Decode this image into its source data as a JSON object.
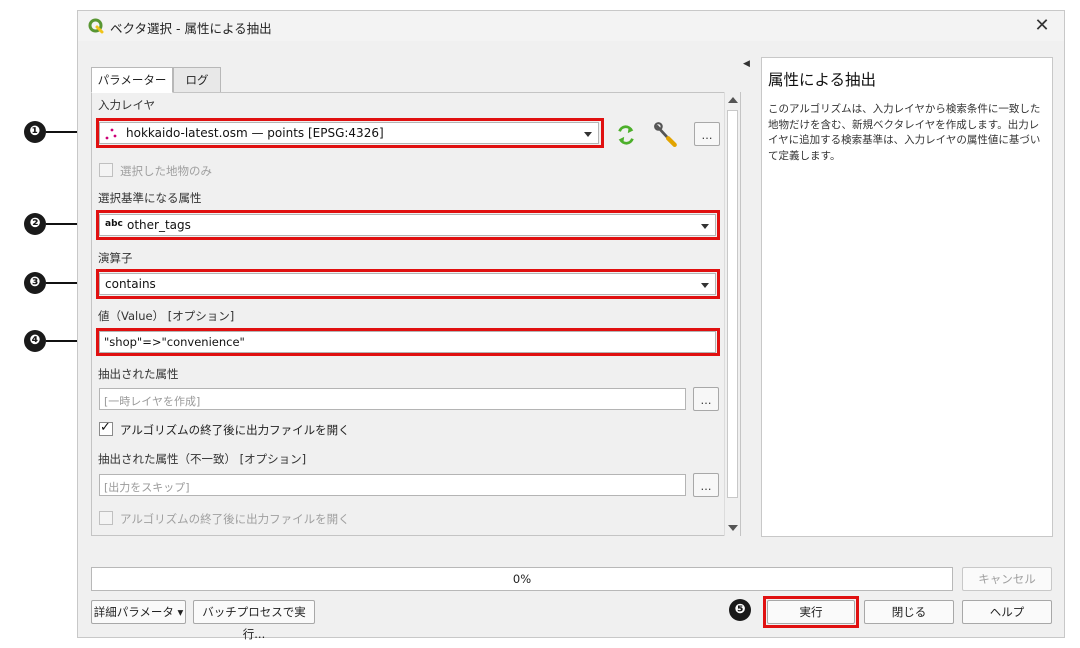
{
  "window": {
    "title": "ベクタ選択 - 属性による抽出",
    "close_glyph": "✕"
  },
  "tabs": [
    {
      "label": "パラメーター"
    },
    {
      "label": "ログ"
    }
  ],
  "params": {
    "input_layer": {
      "label": "入力レイヤ",
      "value": "hokkaido-latest.osm — points [EPSG:4326]",
      "dots": "…"
    },
    "selected_only": {
      "label": "選択した地物のみ",
      "checked": false
    },
    "attribute": {
      "label": "選択基準になる属性",
      "type_badge": "abc",
      "value": "other_tags"
    },
    "operator": {
      "label": "演算子",
      "value": "contains"
    },
    "value": {
      "label": "値（Value） [オプション]",
      "value": "\"shop\"=>\"convenience\""
    },
    "extracted": {
      "label": "抽出された属性",
      "placeholder": "[一時レイヤを作成]",
      "dots": "…"
    },
    "open_after": {
      "label": "アルゴリズムの終了後に出力ファイルを開く",
      "checked": true,
      "check_glyph": "✓"
    },
    "non_matching": {
      "label": "抽出された属性（不一致） [オプション]",
      "placeholder": "[出力をスキップ]",
      "dots": "…"
    },
    "open_after_2": {
      "label": "アルゴリズムの終了後に出力ファイルを開く",
      "checked": false
    }
  },
  "help": {
    "title": "属性による抽出",
    "body": "このアルゴリズムは、入力レイヤから検索条件に一致した地物だけを含む、新規ベクタレイヤを作成します。出力レイヤに追加する検索基準は、入力レイヤの属性値に基づいて定義します。"
  },
  "progress": {
    "value": 0,
    "label": "0%"
  },
  "buttons": {
    "cancel": "キャンセル",
    "advanced": "詳細パラメータ ▾",
    "batch": "バッチプロセスで実行...",
    "run": "実行",
    "close": "閉じる",
    "help": "ヘルプ"
  },
  "callouts": [
    "❶",
    "❷",
    "❸",
    "❹",
    "❺"
  ],
  "colors": {
    "highlight": "#e01010",
    "qgis_green": "#589632",
    "qgis_yellow": "#f0c419"
  }
}
